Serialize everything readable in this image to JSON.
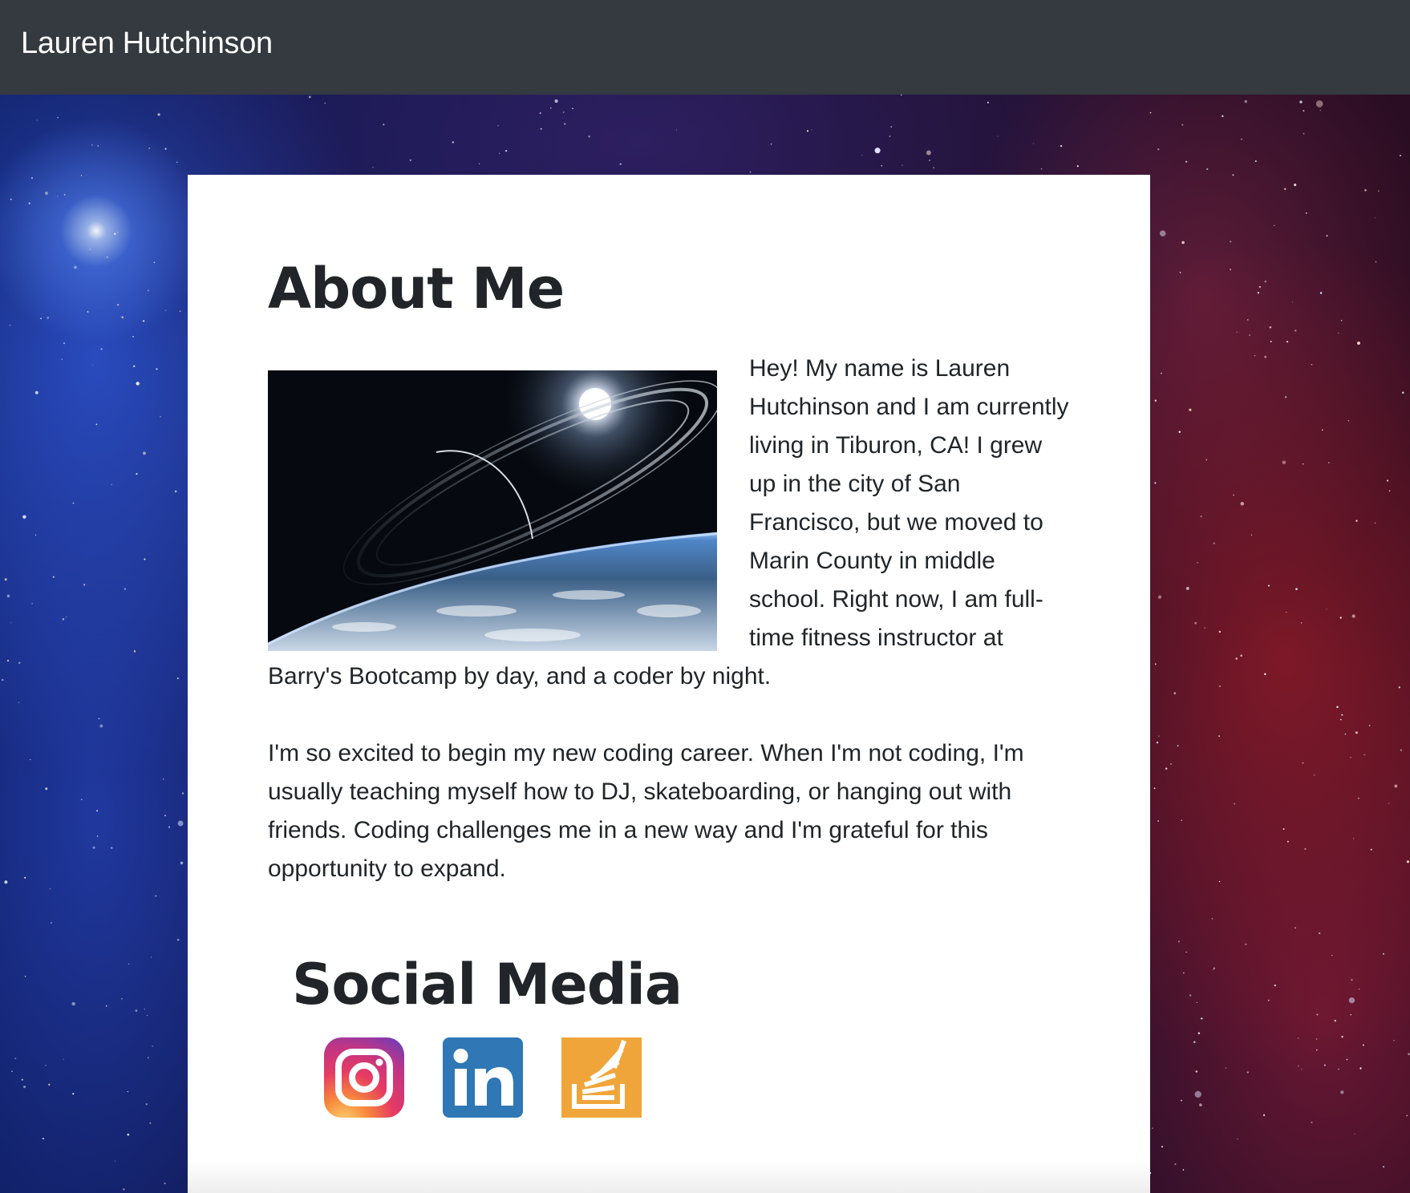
{
  "navbar": {
    "brand": "Lauren Hutchinson"
  },
  "about": {
    "title": "About Me",
    "photo_alt": "planet-in-space-image",
    "paragraph_1": "Hey! My name is Lauren Hutchinson and I am currently living in Tiburon, CA! I grew up in the city of San Francisco, but we moved to Marin County in middle school. Right now, I am full-time fitness instructor at Barry's Bootcamp by day, and a coder by night.",
    "paragraph_2": "I'm so excited to begin my new coding career. When I'm not coding, I'm usually teaching myself how to DJ, skateboarding, or hanging out with friends. Coding challenges me in a new way and I'm grateful for this opportunity to expand."
  },
  "social": {
    "title": "Social Media",
    "links": [
      {
        "icon": "instagram-icon",
        "color": "#c13584"
      },
      {
        "icon": "linkedin-icon",
        "color": "#2f77b5"
      },
      {
        "icon": "stackoverflow-icon",
        "color": "#f0a53a"
      }
    ]
  },
  "colors": {
    "navbar_bg": "#343a40",
    "text": "#212529",
    "card_bg": "#ffffff"
  }
}
